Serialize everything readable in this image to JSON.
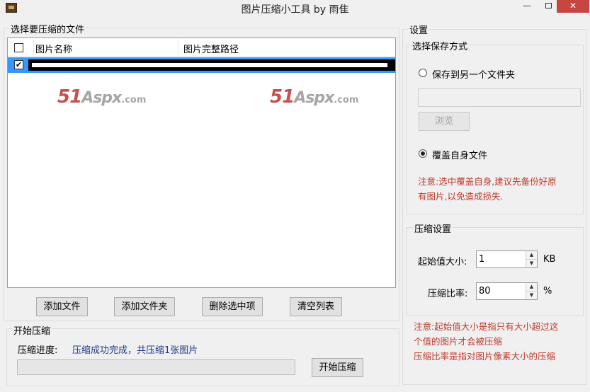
{
  "window": {
    "title": "图片压缩小工具 by 雨隹",
    "min_glyph": "—",
    "close_glyph": "✕"
  },
  "files_group": {
    "title": "选择要压缩的文件",
    "columns": [
      "图片名称",
      "图片完整路径"
    ],
    "rows": [
      {
        "checked": true,
        "check_glyph": "✔"
      }
    ]
  },
  "watermarks": [
    {
      "num": "51",
      "brand": "Aspx",
      "tld": ".com"
    },
    {
      "num": "51",
      "brand": "Aspx",
      "tld": ".com"
    }
  ],
  "file_buttons": {
    "add_file": "添加文件",
    "add_folder": "添加文件夹",
    "delete_selected": "删除选中项",
    "clear_list": "清空列表"
  },
  "compress_group": {
    "title": "开始压缩",
    "progress_label": "压缩进度:",
    "status_text": "压缩成功完成，共压缩1张图片",
    "progress_percent": 0,
    "start_button": "开始压缩"
  },
  "settings": {
    "title": "设置",
    "save_mode": {
      "title": "选择保存方式",
      "option_other_folder": "保存到另一个文件夹",
      "option_other_folder_selected": false,
      "folder_path_value": "",
      "browse_button": "浏览",
      "option_overwrite": "覆盖自身文件",
      "option_overwrite_selected": true,
      "warning": [
        "注意:选中覆盖自身,建议先备份好原",
        "有图片,以免造成损失."
      ]
    },
    "compression": {
      "title": "压缩设置",
      "min_size_label": "起始值大小:",
      "min_size_value": "1",
      "min_size_unit": "KB",
      "ratio_label": "压缩比率:",
      "ratio_value": "80",
      "ratio_unit": "%",
      "up_glyph": "▲",
      "down_glyph": "▼"
    },
    "note": [
      "注意:起始值大小是指只有大小超过这",
      "个值的图片才会被压缩",
      "压缩比率是指对图片像素大小的压缩"
    ]
  },
  "colors": {
    "selection": "#3399ff",
    "warning_text": "#c0392b",
    "status_text": "#1f3a8a",
    "close_button": "#c7463f",
    "watermark_red": "#c8504f"
  }
}
